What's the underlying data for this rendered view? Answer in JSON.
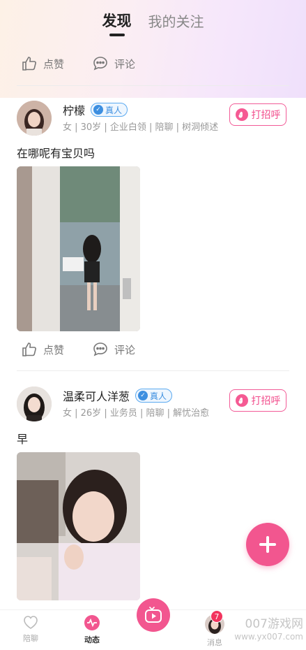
{
  "header": {
    "tabs": [
      {
        "label": "发现",
        "active": true
      },
      {
        "label": "我的关注",
        "active": false
      }
    ]
  },
  "actions": {
    "like_label": "点赞",
    "comment_label": "评论"
  },
  "posts": [
    {
      "name": "柠檬",
      "verified_label": "真人",
      "tags": "女 | 30岁 | 企业白领 | 陪聊 | 树洞倾述",
      "greet_label": "打招呼",
      "text": "在哪呢有宝贝吗"
    },
    {
      "name": "温柔可人洋葱",
      "verified_label": "真人",
      "tags": "女 | 26岁 | 业务员 | 陪聊 | 解忧治愈",
      "greet_label": "打招呼",
      "text": "早"
    }
  ],
  "bottom_nav": {
    "items": [
      {
        "label": "陪聊",
        "icon": "heart-icon"
      },
      {
        "label": "动态",
        "icon": "pulse-icon",
        "active": true
      },
      {
        "label": "",
        "icon": "play-tv-icon"
      },
      {
        "label": "消息",
        "icon": "avatar",
        "badge": "7"
      }
    ]
  },
  "watermark": {
    "line1": "007游戏网",
    "line2": "www.yx007.com"
  },
  "colors": {
    "accent": "#f2568f",
    "verified": "#3d8fe0"
  }
}
